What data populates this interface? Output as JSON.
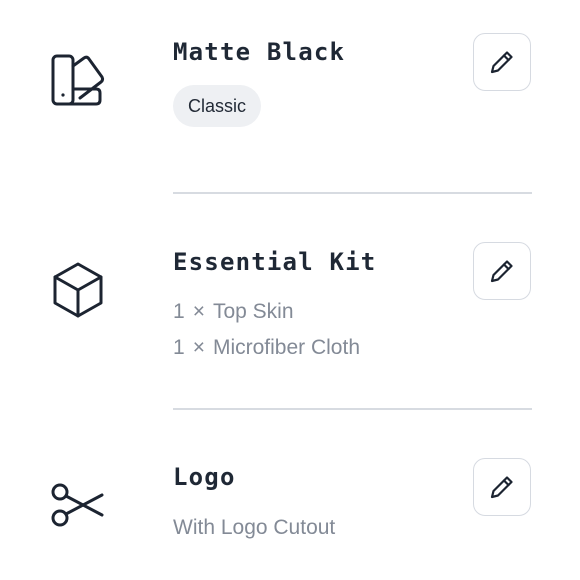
{
  "items": [
    {
      "title": "Matte Black",
      "icon": "color-swatch-icon",
      "badge": "Classic",
      "edit_icon": "pencil-icon"
    },
    {
      "title": "Essential Kit",
      "icon": "cube-icon",
      "lines": [
        {
          "qty": "1",
          "sep": "×",
          "name": "Top Skin"
        },
        {
          "qty": "1",
          "sep": "×",
          "name": "Microfiber Cloth"
        }
      ],
      "edit_icon": "pencil-icon"
    },
    {
      "title": "Logo",
      "icon": "scissors-icon",
      "detail": "With Logo Cutout",
      "edit_icon": "pencil-icon"
    }
  ],
  "colors": {
    "title": "#1f2835",
    "secondary_text": "#838a96",
    "badge_bg": "#eef0f3",
    "divider": "#d7dbe1",
    "button_border": "#d6dae1"
  }
}
